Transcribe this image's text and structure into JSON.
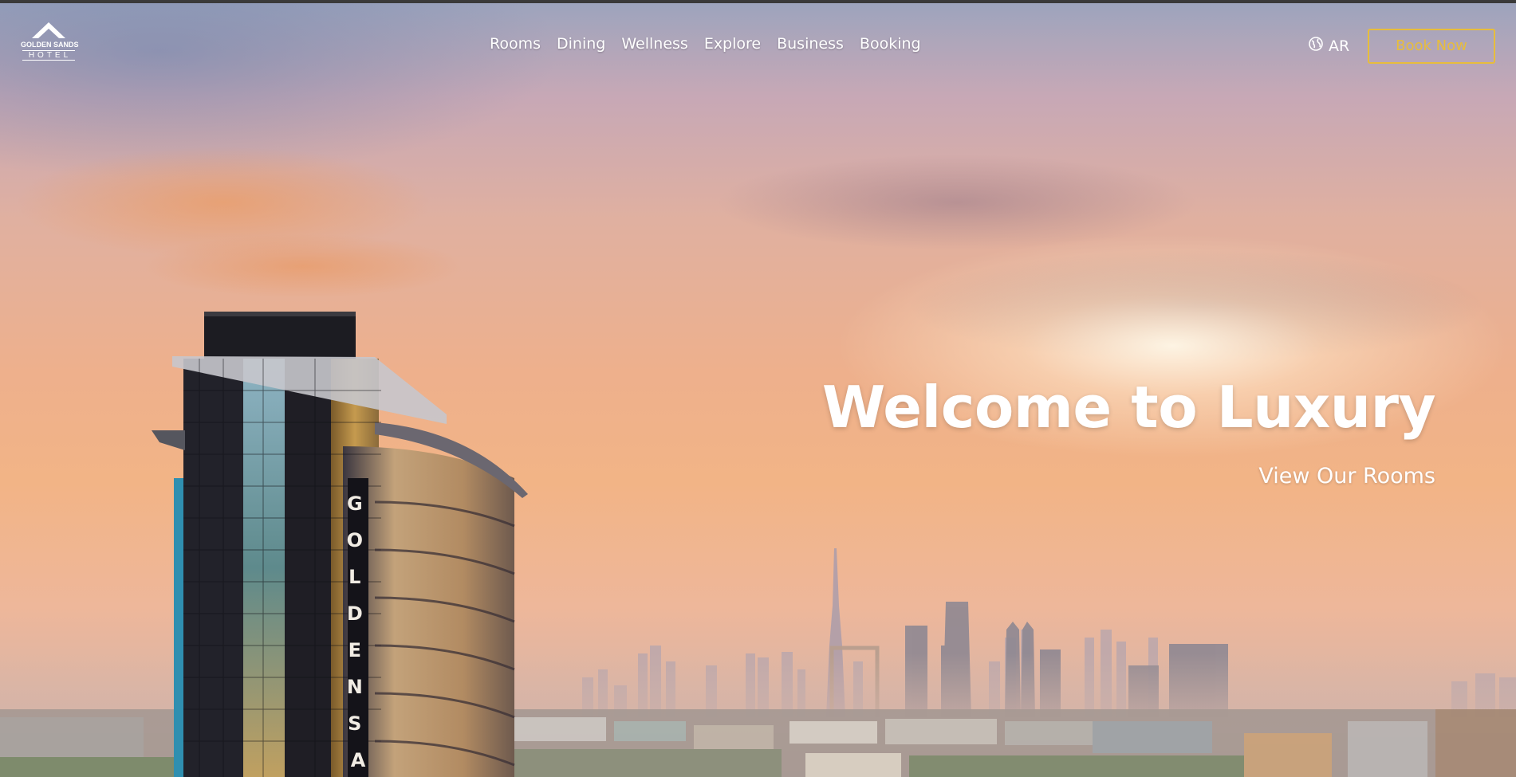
{
  "brand": {
    "name": "GOLDEN SANDS",
    "sub": "HOTEL"
  },
  "nav": {
    "items": [
      {
        "label": "Rooms"
      },
      {
        "label": "Dining"
      },
      {
        "label": "Wellness"
      },
      {
        "label": "Explore"
      },
      {
        "label": "Business"
      },
      {
        "label": "Booking"
      }
    ],
    "language_label": "AR",
    "language_icon": "globe-icon",
    "book_label": "Book Now"
  },
  "hero": {
    "title": "Welcome to Luxury",
    "cta_label": "View Our Rooms",
    "tower_sign": "GOLDEN SA"
  },
  "colors": {
    "accent": "#e7bd3c",
    "text": "#ffffff"
  }
}
